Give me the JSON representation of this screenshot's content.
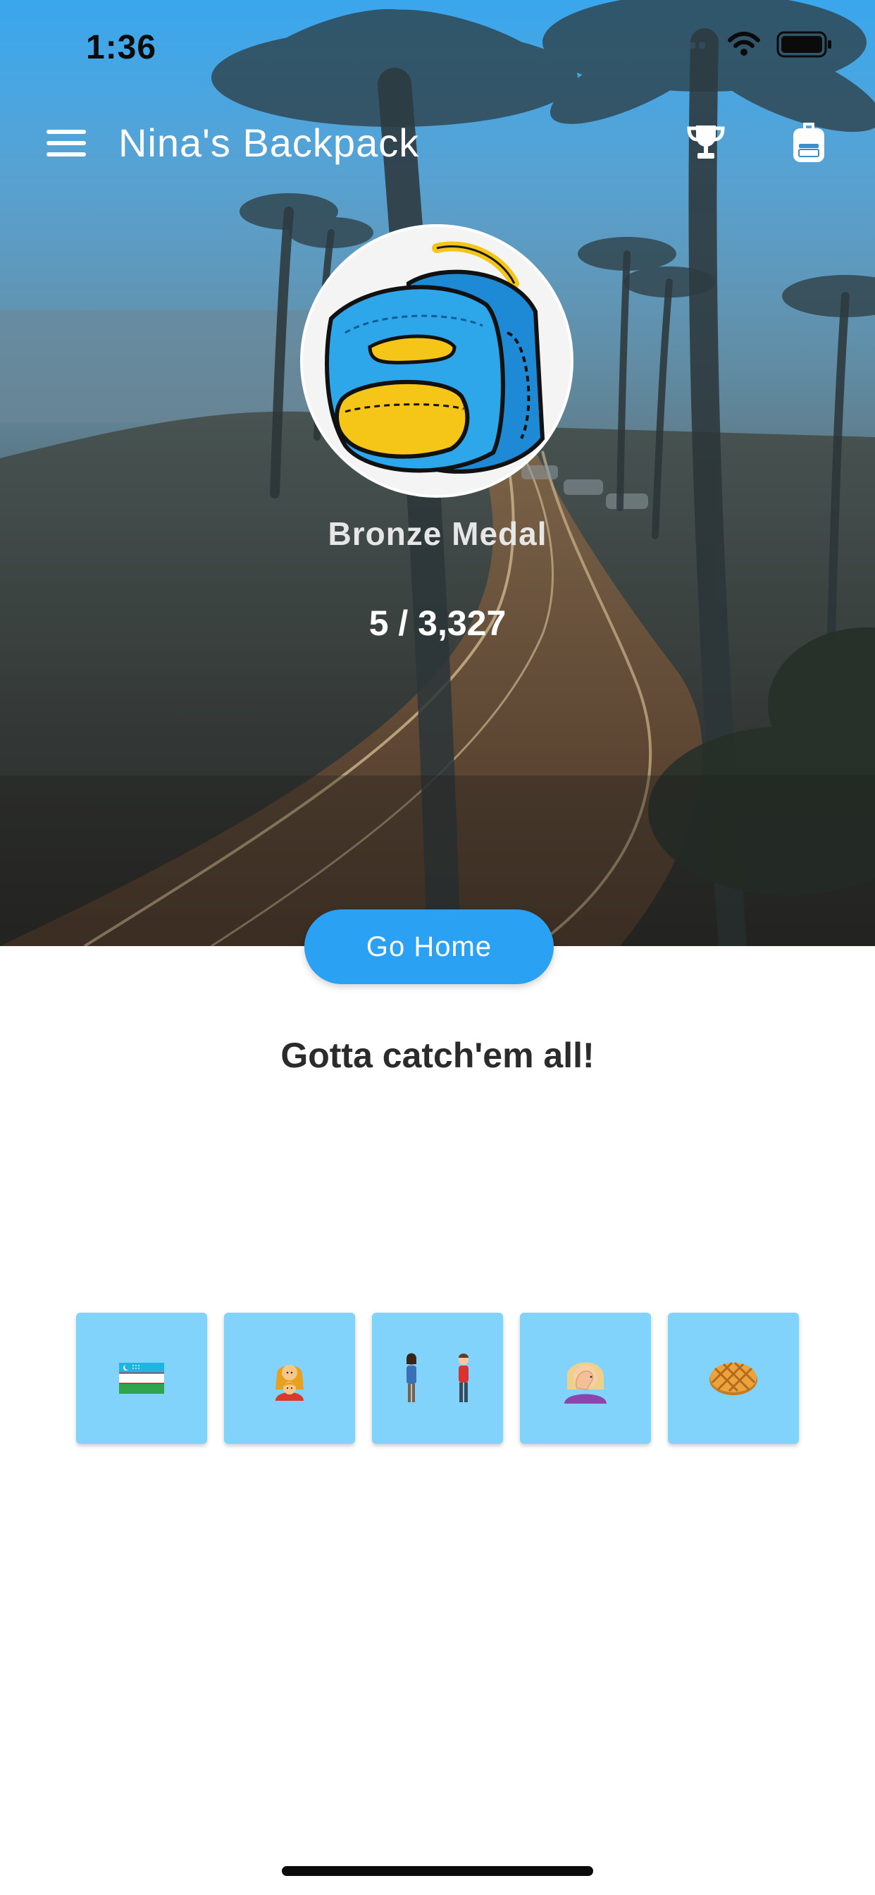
{
  "status_bar": {
    "time": "1:36"
  },
  "app_bar": {
    "title": "Nina's Backpack",
    "icons": [
      "menu-icon",
      "trophy-icon",
      "backpack-icon"
    ]
  },
  "profile": {
    "avatar_icon": "backpack-avatar",
    "medal": "Bronze Medal",
    "score": "5 / 3,327"
  },
  "actions": {
    "go_home_label": "Go Home"
  },
  "headline": "Gotta catch'em all!",
  "collection": [
    {
      "name": "uzbekistan-flag-emoji"
    },
    {
      "name": "mother-and-child-emoji"
    },
    {
      "name": "couple-emoji"
    },
    {
      "name": "woman-facepalming-emoji"
    },
    {
      "name": "waffle-emoji"
    }
  ],
  "colors": {
    "accent": "#2aa1f3",
    "tile": "#82d3fb",
    "headline": "#2b2b2b"
  }
}
